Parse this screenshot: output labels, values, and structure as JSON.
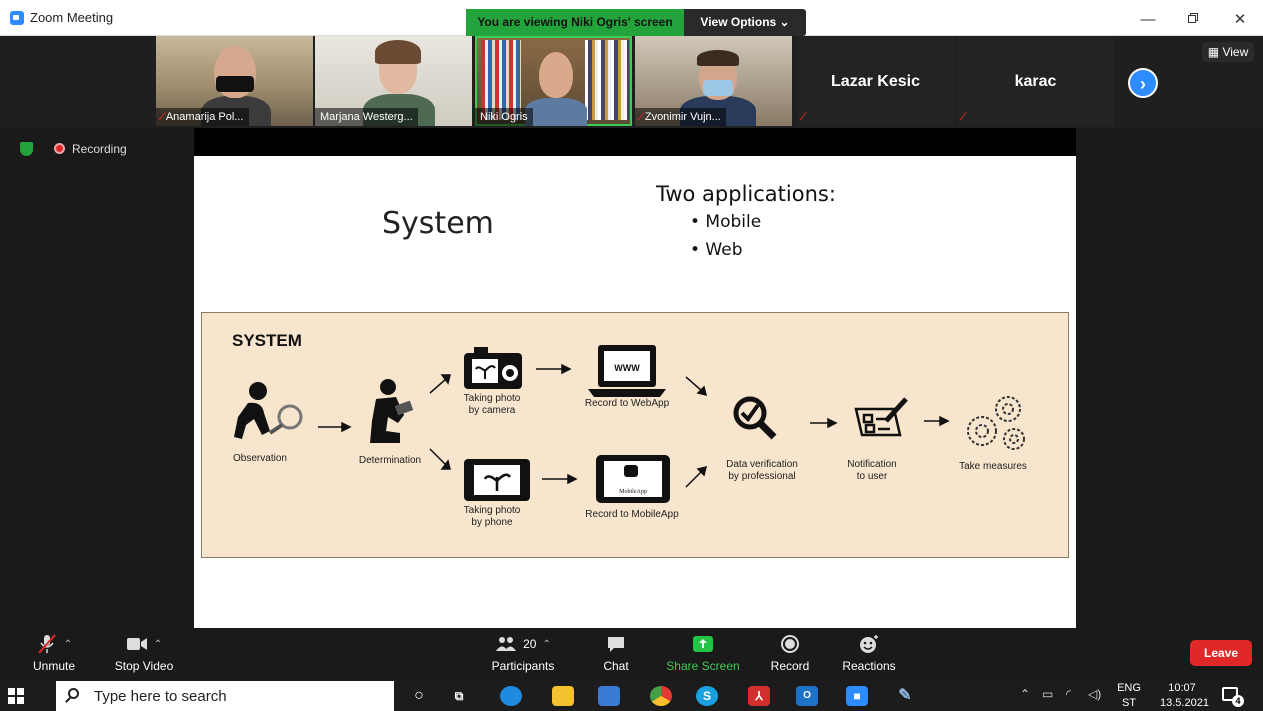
{
  "window": {
    "title": "Zoom Meeting"
  },
  "banner": {
    "viewing": "You are viewing Niki Ogris' screen",
    "view_options": "View Options ⌄"
  },
  "gallery": {
    "participants": [
      {
        "name": "Anamarija Pol...",
        "muted": true
      },
      {
        "name": "Marjana Westerg...",
        "muted": false
      },
      {
        "name": "Niki Ogris",
        "muted": false,
        "active": true
      },
      {
        "name": "Zvonimir Vujn...",
        "muted": true
      },
      {
        "name": "Lazar Kesic",
        "muted": true,
        "video_off": true
      },
      {
        "name": "karac",
        "muted": true,
        "video_off": true
      }
    ],
    "view_label": "View"
  },
  "recording": {
    "label": "Recording"
  },
  "slide": {
    "title": "System",
    "apps_heading": "Two applications:",
    "apps": [
      "• Mobile",
      "• Web"
    ],
    "diagram": {
      "title": "SYSTEM",
      "steps": {
        "observation": "Observation",
        "determination": "Determination",
        "photo_camera": "Taking photo\nby camera",
        "photo_phone": "Taking photo\nby phone",
        "record_web": "Record to WebApp",
        "record_mobile": "Record to MobileApp",
        "verification": "Data verification\nby professional",
        "notification": "Notification\nto user",
        "measures": "Take measures"
      },
      "laptop_text": "WWW",
      "phone_text": "MobileApp"
    }
  },
  "toolbar": {
    "unmute": "Unmute",
    "stop_video": "Stop Video",
    "participants": "Participants",
    "participants_count": "20",
    "chat": "Chat",
    "share_screen": "Share Screen",
    "record": "Record",
    "reactions": "Reactions",
    "leave": "Leave"
  },
  "taskbar": {
    "search_placeholder": "Type here to search",
    "lang_1": "ENG",
    "lang_2": "ST",
    "time": "10:07",
    "date": "13.5.2021",
    "notifications": "4"
  },
  "colors": {
    "zoom_blue": "#2d8cff",
    "share_green": "#23a33c",
    "leave_red": "#e02828",
    "diagram_bg": "#f7e5cd"
  }
}
